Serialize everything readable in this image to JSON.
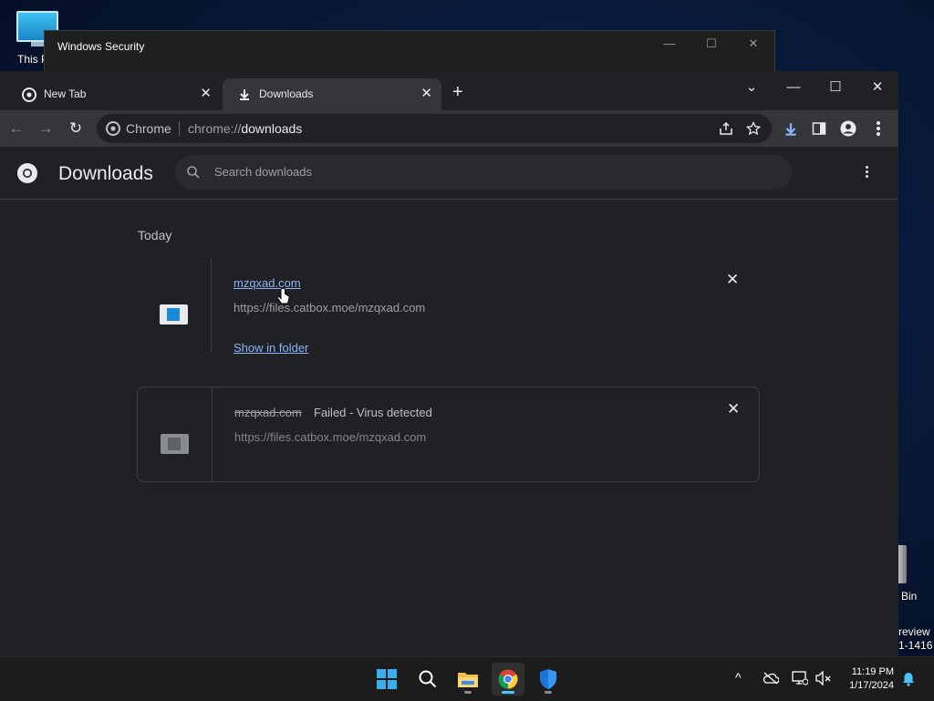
{
  "desktop": {
    "this_pc_label": "This P",
    "recycle_label": "Bin",
    "watermark_line1": "review",
    "watermark_line2": "1-1416"
  },
  "windows_security": {
    "title": "Windows Security",
    "minimize": "—",
    "maximize": "☐",
    "close": "✕"
  },
  "chrome": {
    "tabs": [
      {
        "label": "New Tab",
        "icon": "chrome-icon",
        "close": "✕"
      },
      {
        "label": "Downloads",
        "icon": "download-icon",
        "close": "✕",
        "active": true
      }
    ],
    "new_tab": "+",
    "window_controls": {
      "tab_search": "⌄",
      "minimize": "—",
      "maximize": "☐",
      "close": "✕"
    },
    "toolbar": {
      "back": "←",
      "forward": "→",
      "reload": "↻",
      "chip": "Chrome",
      "url_scheme": "chrome://",
      "url_path": "downloads"
    }
  },
  "downloads_page": {
    "title": "Downloads",
    "search_placeholder": "Search downloads",
    "section_label": "Today",
    "items": [
      {
        "filename": "mzqxad.com",
        "source": "https://files.catbox.moe/mzqxad.com",
        "action": "Show in folder",
        "remove": "✕"
      },
      {
        "filename": "mzqxad.com",
        "status": "Failed - Virus detected",
        "source": "https://files.catbox.moe/mzqxad.com",
        "remove": "✕"
      }
    ]
  },
  "taskbar": {
    "apps": [
      "start-icon",
      "search-icon",
      "file-explorer-icon",
      "chrome-icon",
      "windows-security-icon"
    ],
    "tray_chevron": "^",
    "time": "11:19 PM",
    "date": "1/17/2024"
  },
  "colors": {
    "accent": "#8ab4f8",
    "page_bg": "#202124",
    "toolbar_bg": "#35363a"
  }
}
